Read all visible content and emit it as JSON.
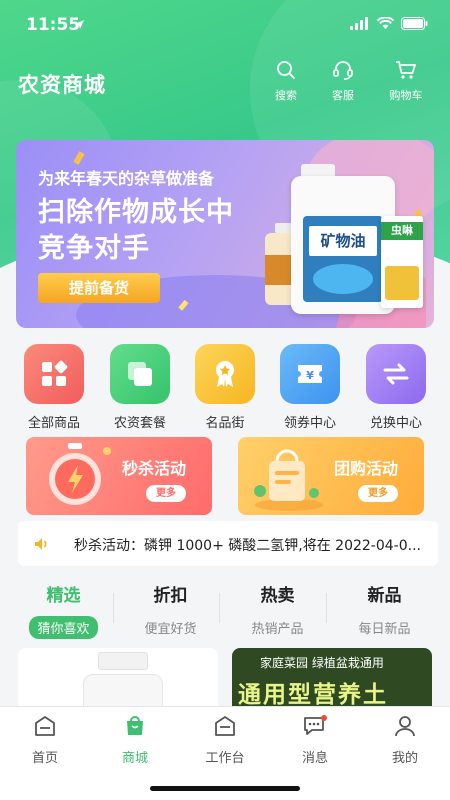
{
  "status_bar": {
    "time": "11:55"
  },
  "header": {
    "title": "农资商城",
    "actions": [
      {
        "label": "搜索",
        "icon": "search-icon"
      },
      {
        "label": "客服",
        "icon": "headset-icon"
      },
      {
        "label": "购物车",
        "icon": "cart-icon"
      }
    ]
  },
  "banner": {
    "subtitle": "为来年春天的杂草做准备",
    "headline_line1": "扫除作物成长中",
    "headline_line2": "竞争对手",
    "cta": "提前备货",
    "product_label_main": "矿物油",
    "product_label_side": "虫啉"
  },
  "categories": [
    {
      "label": "全部商品",
      "icon": "grid-icon",
      "color": "#f6716a"
    },
    {
      "label": "农资套餐",
      "icon": "package-icon",
      "color": "#4fd27a"
    },
    {
      "label": "名品街",
      "icon": "award-icon",
      "color": "#f9c233"
    },
    {
      "label": "领券中心",
      "icon": "coupon-icon",
      "color": "#4ea8f5"
    },
    {
      "label": "兑换中心",
      "icon": "exchange-icon",
      "color": "#a57ef5"
    }
  ],
  "promos": [
    {
      "title": "秒杀活动",
      "more": "更多",
      "icon": "stopwatch-icon"
    },
    {
      "title": "团购活动",
      "more": "更多",
      "icon": "shopping-bag-icon"
    }
  ],
  "notice": {
    "text": "秒杀活动：磷钾 1000+ 磷酸二氢钾,将在 2022-04-0..."
  },
  "tabs": [
    {
      "title": "精选",
      "subtitle": "猜你喜欢"
    },
    {
      "title": "折扣",
      "subtitle": "便宜好货"
    },
    {
      "title": "热卖",
      "subtitle": "热销产品"
    },
    {
      "title": "新品",
      "subtitle": "每日新品"
    }
  ],
  "product_cards": {
    "right_line1": "家庭菜园 绿植盆栽通用",
    "right_line2": "通用型营养土"
  },
  "tabbar": [
    {
      "label": "首页",
      "icon": "home-icon"
    },
    {
      "label": "商城",
      "icon": "shop-bag-icon"
    },
    {
      "label": "工作台",
      "icon": "workbench-icon"
    },
    {
      "label": "消息",
      "icon": "message-icon"
    },
    {
      "label": "我的",
      "icon": "profile-icon"
    }
  ],
  "colors": {
    "brand_green": "#3fbf6f",
    "header_green": "#4fd78b"
  }
}
